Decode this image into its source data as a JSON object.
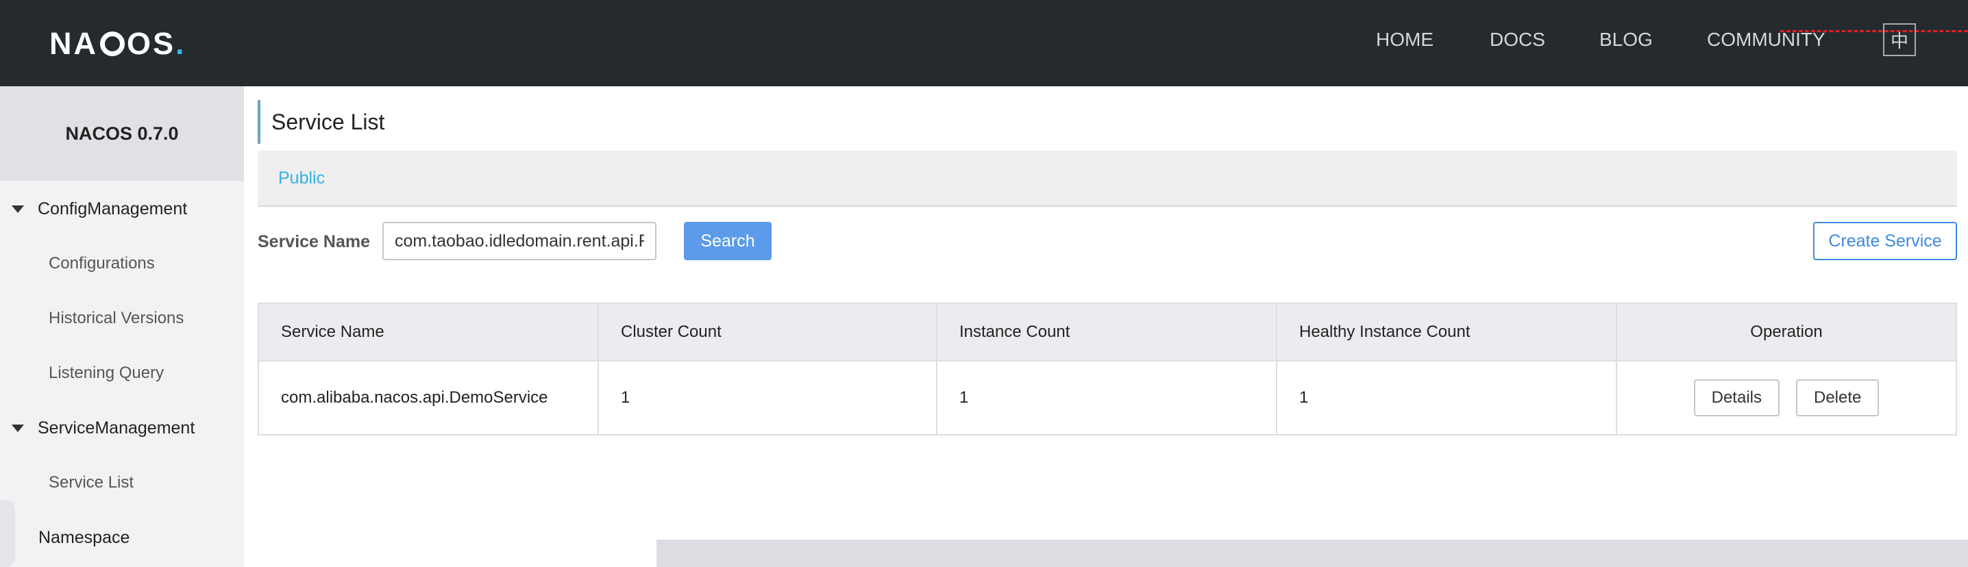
{
  "header": {
    "logo": {
      "prefix": "NA",
      "suffix": "OS",
      "dot": "."
    },
    "nav": [
      "HOME",
      "DOCS",
      "BLOG",
      "COMMUNITY"
    ],
    "lang_toggle": "中"
  },
  "sidebar": {
    "version": "NACOS 0.7.0",
    "groups": [
      {
        "label": "ConfigManagement",
        "items": [
          "Configurations",
          "Historical Versions",
          "Listening Query"
        ]
      },
      {
        "label": "ServiceManagement",
        "items": [
          "Service List"
        ]
      }
    ],
    "single_items": [
      "Namespace"
    ]
  },
  "main": {
    "title": "Service List",
    "namespace": "Public",
    "search": {
      "label": "Service Name",
      "value": "com.taobao.idledomain.rent.api.R",
      "button": "Search"
    },
    "create_button": "Create Service",
    "table": {
      "headers": [
        "Service Name",
        "Cluster Count",
        "Instance Count",
        "Healthy Instance Count",
        "Operation"
      ],
      "rows": [
        {
          "service_name": "com.alibaba.nacos.api.DemoService",
          "cluster_count": "1",
          "instance_count": "1",
          "healthy_instance_count": "1"
        }
      ],
      "row_actions": [
        "Details",
        "Delete"
      ]
    }
  },
  "colors": {
    "header_bg": "#252a2f",
    "accent_link": "#33b1e3",
    "primary_button": "#5b9bea",
    "annotation_red": "#e02020"
  }
}
